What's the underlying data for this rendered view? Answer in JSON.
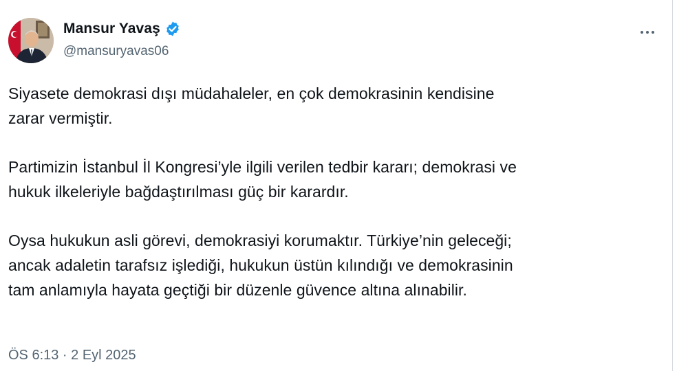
{
  "author": {
    "display_name": "Mansur Yavaş",
    "handle": "@mansuryavas06",
    "verified": true,
    "avatar_icon": "profile-photo"
  },
  "menu": {
    "icon": "more-horizontal-icon"
  },
  "tweet": {
    "paragraphs": [
      "Siyasete demokrasi dışı müdahaleler, en çok demokrasinin kendisine\nzarar vermiştir.",
      "Partimizin İstanbul İl Kongresi’yle ilgili verilen tedbir kararı; demokrasi ve\nhukuk ilkeleriyle bağdaştırılması güç bir karardır.",
      "Oysa hukukun asli görevi, demokrasiyi korumaktır. Türkiye’nin geleceği;\nancak adaletin tarafsız işlediği, hukukun üstün kılındığı ve demokrasinin\ntam anlamıyla hayata geçtiği bir düzenle güvence altına alınabilir."
    ],
    "timestamp": "ÖS 6:13 · 2 Eyl 2025"
  },
  "colors": {
    "text": "#0f1419",
    "secondary": "#536471",
    "verified_blue": "#1d9bf0"
  }
}
